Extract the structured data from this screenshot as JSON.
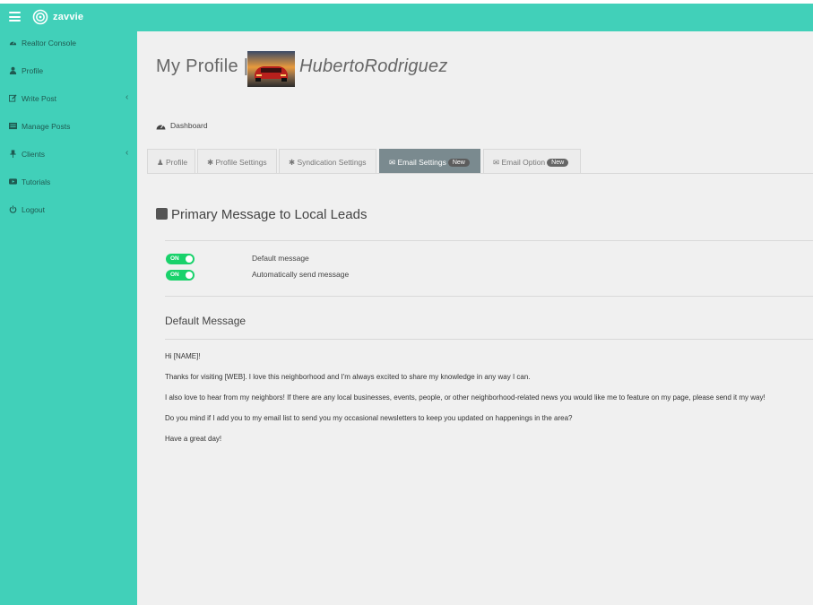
{
  "header": {
    "logo_text": "zavvie"
  },
  "sidebar": {
    "items": [
      {
        "label": "Realtor Console",
        "icon": "dashboard-icon"
      },
      {
        "label": "Profile",
        "icon": "user-icon"
      },
      {
        "label": "Write Post",
        "icon": "edit-icon",
        "has_submenu": true
      },
      {
        "label": "Manage Posts",
        "icon": "list-icon"
      },
      {
        "label": "Clients",
        "icon": "pin-icon",
        "has_submenu": true
      },
      {
        "label": "Tutorials",
        "icon": "video-icon"
      },
      {
        "label": "Logout",
        "icon": "power-icon"
      }
    ],
    "chevron": "‹"
  },
  "profile": {
    "title": "My Profile |",
    "user_name": "HubertoRodriguez"
  },
  "breadcrumb": {
    "label": "Dashboard"
  },
  "tabs": [
    {
      "label": "Profile",
      "icon": "user-icon",
      "active": false
    },
    {
      "label": "Profile Settings",
      "icon": "gear-icon",
      "active": false
    },
    {
      "label": "Syndication Settings",
      "icon": "gear-icon",
      "active": false
    },
    {
      "label": "Email Settings",
      "icon": "envelope-icon",
      "active": true,
      "badge": "New"
    },
    {
      "label": "Email Option",
      "icon": "envelope-icon",
      "active": false,
      "badge": "New"
    }
  ],
  "section": {
    "title": "Primary Message to Local Leads"
  },
  "toggles": [
    {
      "state": "ON",
      "label": "Default message"
    },
    {
      "state": "ON",
      "label": "Automatically send message"
    }
  ],
  "default_message": {
    "heading": "Default Message",
    "lines": [
      "Hi [NAME]!",
      "Thanks for visiting [WEB]. I love this neighborhood and I'm always excited to share my knowledge in any way I can.",
      "I also love to hear from my neighbors! If there are any local businesses, events, people, or other neighborhood-related news you would like me to feature on my page, please send it my way!",
      "Do you mind if I add you to my email list to send you my occasional newsletters to keep you updated on happenings in the area?",
      "Have a great day!"
    ]
  },
  "colors": {
    "brand_teal": "#41d0b9",
    "toggle_green": "#19d26b",
    "active_tab": "#7a8a8f"
  }
}
